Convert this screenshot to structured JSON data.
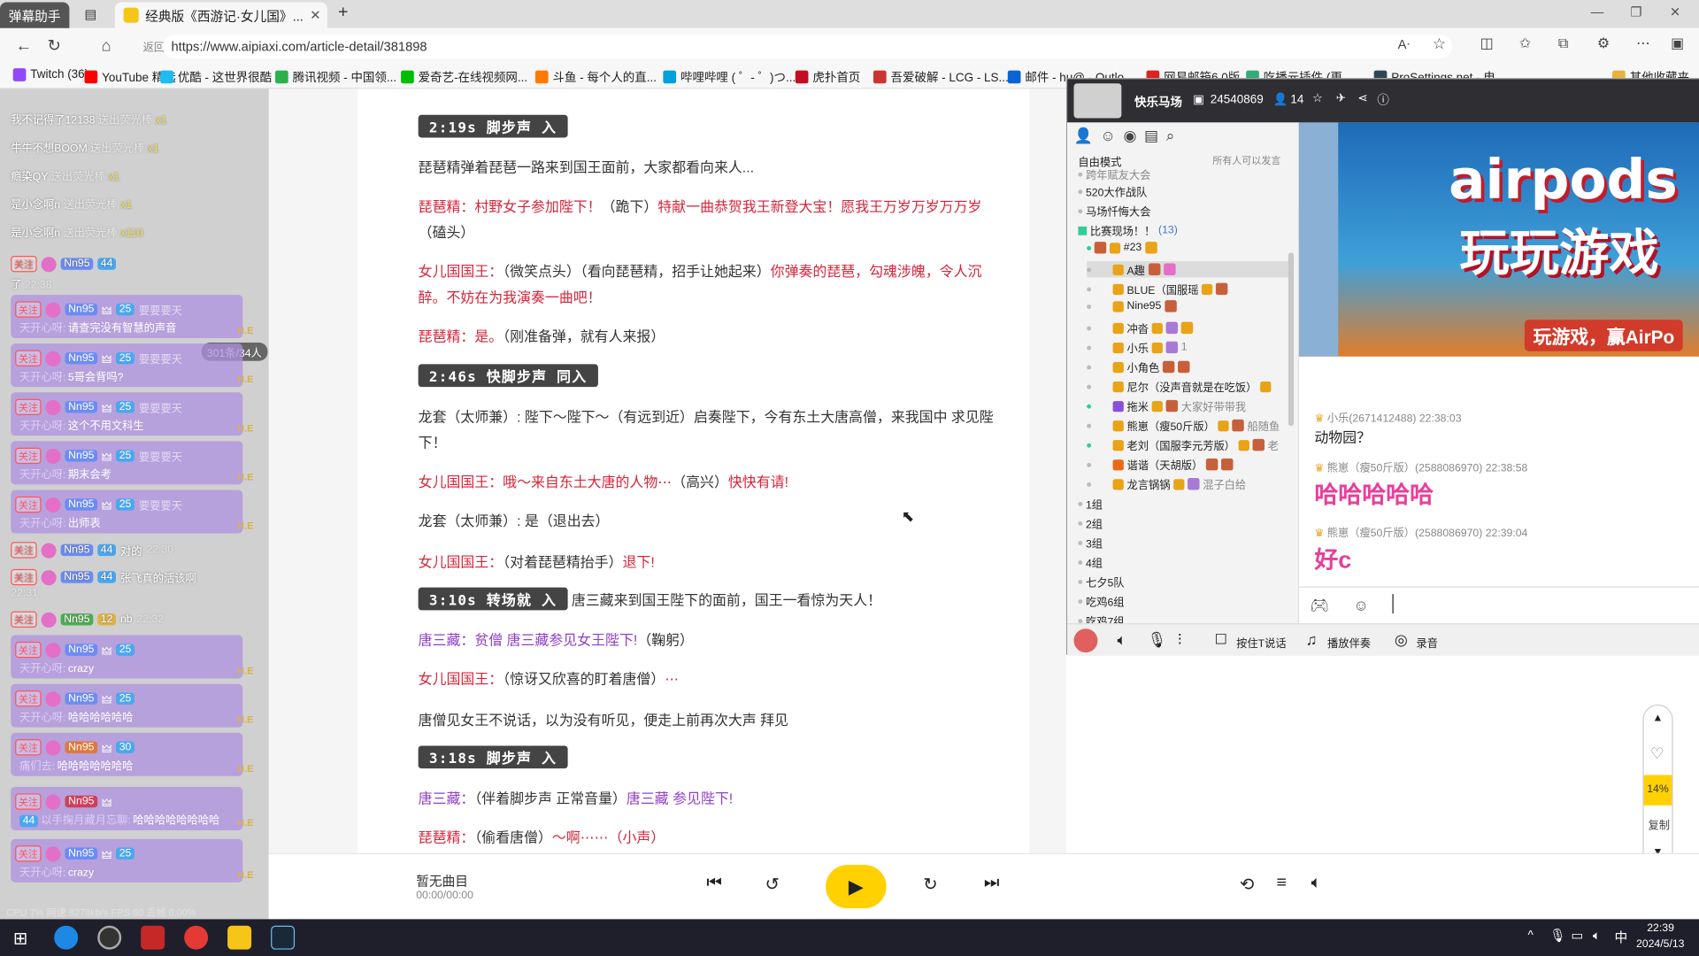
{
  "browser": {
    "tabs": [
      {
        "label": "弹幕助手"
      },
      {
        "label": "经典版《西游记·女儿国》..."
      }
    ],
    "address_url": "https://www.aipiaxi.com/article-detail/381898",
    "back_overlay_text": "返回",
    "bookmarks": [
      "Twitch (36)",
      "YouTube 精选",
      "优酷 - 这世界很酷",
      "腾讯视频 - 中国领...",
      "爱奇艺-在线视频网...",
      "斗鱼 - 每个人的直...",
      "哔哩哔哩 ( ゜- ゜)つ...",
      "虎扑首页",
      "吾爱破解 - LCG - LS...",
      "邮件 - hu@ - Outlo...",
      "网易邮箱6.0版",
      "吃播元插件 (更...",
      "ProSettings.net - 电...",
      "其他收藏夹"
    ]
  },
  "danmaku": {
    "simple": [
      {
        "user": "我不记得了12138",
        "action": "送出荧光棒",
        "count": "x1"
      },
      {
        "user": "牛牛不想BOOM",
        "action": "送出荧光棒",
        "count": "x1"
      },
      {
        "user": "瘾染QY",
        "action": "送出荧光棒",
        "count": "x1"
      },
      {
        "user": "是小念啊n",
        "action": "送出荧光棒",
        "count": "x1"
      },
      {
        "user": "是小念啊n",
        "action": "送出荧光棒",
        "count": "x110"
      }
    ],
    "online_badge": "301条/34人",
    "first": {
      "tag": "关注",
      "fan": "Nn95",
      "lv": "44",
      "tail": "了",
      "time": "22:38"
    },
    "cards": [
      {
        "lv": "25",
        "name": "要要要天",
        "prefix": "天开心呀:",
        "text": "请查完没有智慧的声音"
      },
      {
        "lv": "25",
        "name": "要要要天",
        "prefix": "天开心呀:",
        "text": "5哥会背吗?"
      },
      {
        "lv": "25",
        "name": "要要要天",
        "prefix": "天开心呀:",
        "text": "这个不用文科生"
      },
      {
        "lv": "25",
        "name": "要要要天",
        "prefix": "天开心呀:",
        "text": "期末会考"
      },
      {
        "lv": "25",
        "name": "要要要天",
        "prefix": "天开心呀:",
        "text": "出师表"
      }
    ],
    "plain": [
      {
        "fan": "Nn95",
        "lv": "44",
        "text": "对的",
        "time": "22:30"
      },
      {
        "fan": "Nn95",
        "lv": "44",
        "text": "张飞真的活该啊",
        "time": "22:31"
      },
      {
        "fan": "Nn95",
        "lv": "12",
        "text": "nb",
        "time": "22:32"
      }
    ],
    "cards2": [
      {
        "lv": "25",
        "prefix": "天开心呀:",
        "text": "crazy"
      },
      {
        "lv": "25",
        "prefix": "天开心呀:",
        "text": "哈哈哈哈哈哈"
      },
      {
        "lv": "30",
        "prefix": "痛们去:",
        "text": "哈哈哈哈哈哈哈"
      },
      {
        "lv": "44",
        "prefix": "以手掬月藏月忘聊:",
        "text": "哈哈哈哈哈哈哈哈"
      },
      {
        "lv": "25",
        "prefix": "天开心呀:",
        "text": "crazy"
      }
    ],
    "hie_tag": "H.E",
    "footer": "CPU 7%  网速 8278kb/s  FPS 60  丢帧 0.00%"
  },
  "article": {
    "lines": [
      {
        "type": "time",
        "text": "2:19s 脚步声 入"
      },
      {
        "type": "plain",
        "text": "琵琶精弹着琵琶一路来到国王面前，大家都看向来人..."
      },
      {
        "type": "mixed",
        "a": "琵琶精：村野女子参加陛下！",
        "b": "（跪下）",
        "c": "特献一曲恭贺我王新登大宝！愿我王万岁万岁万万岁"
      },
      {
        "type": "plain2",
        "text": "（磕头）"
      },
      {
        "type": "mixed",
        "a": "女儿国国王：",
        "b": "（微笑点头）（看向琵琶精，招手让她起来）",
        "c": "你弹奏的琵琶，勾魂涉魄，令人沉"
      },
      {
        "type": "red",
        "text": "醉。不妨在为我演奏一曲吧！"
      },
      {
        "type": "mixed",
        "a": "琵琶精：是。",
        "b": "（刚准备弹，就有人来报）",
        "c": ""
      },
      {
        "type": "time",
        "text": "2:46s  快脚步声 同入"
      },
      {
        "type": "plain",
        "text": "龙套（太师兼）: 陛下～陛下～（有远到近）启奏陛下，今有东土大唐高僧，来我国中 求见陛"
      },
      {
        "type": "plain",
        "text": "下！"
      },
      {
        "type": "mixed",
        "a": "女儿国国王：哦～来自东土大唐的人物⋯",
        "b": "（高兴）",
        "c": "快快有请!"
      },
      {
        "type": "plain",
        "text": "龙套（太师兼）: 是（退出去）"
      },
      {
        "type": "mixed",
        "a": "女儿国国王：",
        "b": "（对着琵琶精抬手）",
        "c": "退下!"
      },
      {
        "type": "timemix",
        "time": "3:10s  转场就 入",
        "text": "唐三藏来到国王陛下的面前，国王一看惊为天人！"
      },
      {
        "type": "purplemix",
        "a": "唐三藏：贫僧 唐三藏参见女王陛下!",
        "b": "（鞠躬）"
      },
      {
        "type": "mixed",
        "a": "女儿国国王：",
        "b": "（惊讶又欣喜的盯着唐僧）",
        "c": "⋯"
      },
      {
        "type": "plain",
        "text": "唐僧见女王不说话，以为没有听见，便走上前再次大声 拜见"
      },
      {
        "type": "time",
        "text": "3:18s  脚步声 入"
      },
      {
        "type": "purplemix2",
        "a": "唐三藏：",
        "b": "（伴着脚步声 正常音量）",
        "c": "唐三藏 参见陛下!"
      },
      {
        "type": "mixed",
        "a": "琵琶精：",
        "b": "（偷看唐僧）",
        "c": "～啊⋯⋯（小声）"
      }
    ]
  },
  "panel": {
    "room_name": "快乐马场",
    "room_id": "24540869",
    "members": "14",
    "mode": "自由模式",
    "mode_right": "所有人可以发言",
    "channels_top": [
      {
        "label": "跨年赋友大会"
      },
      {
        "label": "520大作战队"
      },
      {
        "label": "马场忏悔大会"
      }
    ],
    "live_channel": "比赛现场！！",
    "live_count": "(13)",
    "members_list": [
      {
        "name": "#23",
        "note": ""
      },
      {
        "name": "A趣",
        "note": ""
      },
      {
        "name": "BLUE（国服瑶",
        "note": ""
      },
      {
        "name": "Nine95",
        "note": ""
      },
      {
        "name": "冲沓",
        "note": ""
      },
      {
        "name": "小乐",
        "note": "1"
      },
      {
        "name": "小角色",
        "note": ""
      },
      {
        "name": "尼尔（没声音就是在吃饭）",
        "note": ""
      },
      {
        "name": "拖米",
        "note": "大家好带带我"
      },
      {
        "name": "熊崽（瘦50斤版）",
        "note": "船随鱼"
      },
      {
        "name": "老刘（国服李元芳版）",
        "note": "老"
      },
      {
        "name": "谐谐（天胡版）",
        "note": ""
      },
      {
        "name": "龙言锅锅",
        "note": "混子白给"
      }
    ],
    "groups": [
      "1组",
      "2组",
      "3组",
      "4组",
      "七夕5队",
      "吃鸡6组",
      "吃鸡7组"
    ],
    "banner_line1": "airpods",
    "banner_line2": "玩玩游戏",
    "banner_sub": "玩游戏，赢AirPo",
    "messages": [
      {
        "meta": "小乐(2671412488)  22:38:03",
        "text": "动物园？",
        "style": "normal"
      },
      {
        "meta": "熊崽（瘦50斤版）(2588086970)  22:38:58",
        "text": "哈哈哈哈哈",
        "style": "big"
      },
      {
        "meta": "熊崽（瘦50斤版）(2588086970)  22:39:04",
        "text": "好c",
        "style": "big"
      }
    ],
    "footer": {
      "push_talk": "按住T说话",
      "accompany": "播放伴奏",
      "record": "录音"
    }
  },
  "side_widget": {
    "percent": "14%",
    "copy": "复制"
  },
  "player": {
    "title": "暂无曲目",
    "time": "00:00/00:00"
  },
  "taskbar": {
    "time": "22:39",
    "date": "2024/5/13",
    "ime": "中"
  },
  "colors": {
    "accent": "#ffd100",
    "red_text": "#d6243a",
    "purple_text": "#8f3fc7",
    "card_bg": "#ad92e0"
  }
}
